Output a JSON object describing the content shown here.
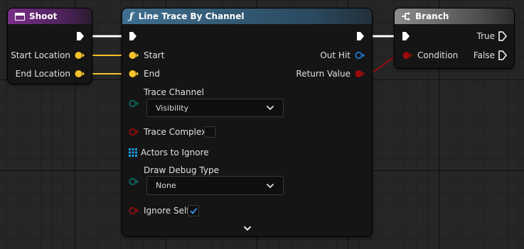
{
  "colors": {
    "shoot_header": "#7a2f8a",
    "trace_header": "#3f6f8f",
    "branch_header": "#8d8d8d",
    "vector_pin": "#f6c22b",
    "bool_pin": "#9a0c0c",
    "struct_pin": "#1f7dd6",
    "byte_pin": "#0a6b63",
    "array_pin": "#1aa0e8",
    "exec": "#ffffff"
  },
  "shoot": {
    "title": "Shoot",
    "icon": "event-icon",
    "pins": [
      "Start Location",
      "End Location"
    ]
  },
  "trace": {
    "title": "Line Trace By Channel",
    "icon": "function-icon",
    "inputs": {
      "start": "Start",
      "end": "End",
      "trace_channel": "Trace Channel",
      "trace_channel_value": "Visibility",
      "trace_complex": "Trace Complex",
      "trace_complex_checked": false,
      "actors_to_ignore": "Actors to Ignore",
      "draw_debug_type": "Draw Debug Type",
      "draw_debug_value": "None",
      "ignore_self": "Ignore Self",
      "ignore_self_checked": true
    },
    "outputs": {
      "out_hit": "Out Hit",
      "return_value": "Return Value"
    },
    "expand_icon": "chevron-down-icon"
  },
  "branch": {
    "title": "Branch",
    "icon": "branch-icon",
    "condition": "Condition",
    "true_label": "True",
    "false_label": "False"
  }
}
